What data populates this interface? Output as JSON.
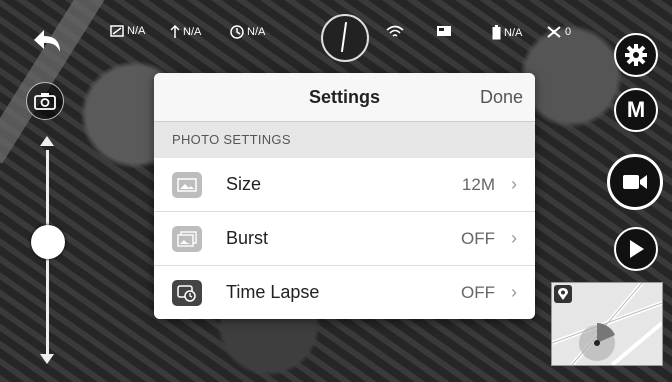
{
  "status_bar": {
    "items": [
      {
        "icon": "signal-icon",
        "value": "N/A"
      },
      {
        "icon": "altitude-icon",
        "value": "N/A"
      },
      {
        "icon": "clock-icon",
        "value": "N/A"
      },
      {
        "icon": "wifi-icon",
        "value": ""
      },
      {
        "icon": "sd-card-icon",
        "value": ""
      },
      {
        "icon": "battery-icon",
        "value": "N/A"
      },
      {
        "icon": "drone-icon",
        "value": "0"
      }
    ]
  },
  "right_controls": {
    "mode_label": "M"
  },
  "settings": {
    "title": "Settings",
    "done_label": "Done",
    "section_title": "PHOTO SETTINGS",
    "rows": [
      {
        "label": "Size",
        "value": "12M",
        "icon": "photo-size-icon"
      },
      {
        "label": "Burst",
        "value": "OFF",
        "icon": "burst-icon"
      },
      {
        "label": "Time Lapse",
        "value": "OFF",
        "icon": "time-lapse-icon"
      }
    ],
    "chevron": "›"
  },
  "camera_slider": {
    "level": 0.45
  }
}
